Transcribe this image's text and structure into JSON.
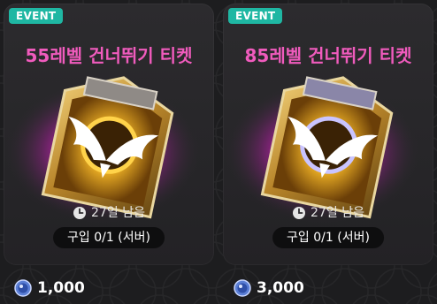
{
  "items": [
    {
      "badge": "EVENT",
      "title": "55레벨 건너뛰기 티켓",
      "time_left": "27일 남음",
      "purchase": "구입 0/1 (서버)",
      "price": "1,000",
      "glow_color": "#ff2fd6"
    },
    {
      "badge": "EVENT",
      "title": "85레벨 건너뛰기 티켓",
      "time_left": "27일 남음",
      "purchase": "구입 0/1 (서버)",
      "price": "3,000",
      "glow_color": "#ff2fd6"
    }
  ],
  "colors": {
    "badge_bg": "#1fb7a3",
    "title": "#f05bbd",
    "card_bg": "#2c2b2e",
    "page_bg": "#1d1d1f"
  },
  "icons": {
    "clock": "clock-icon",
    "currency": "coin-icon"
  }
}
